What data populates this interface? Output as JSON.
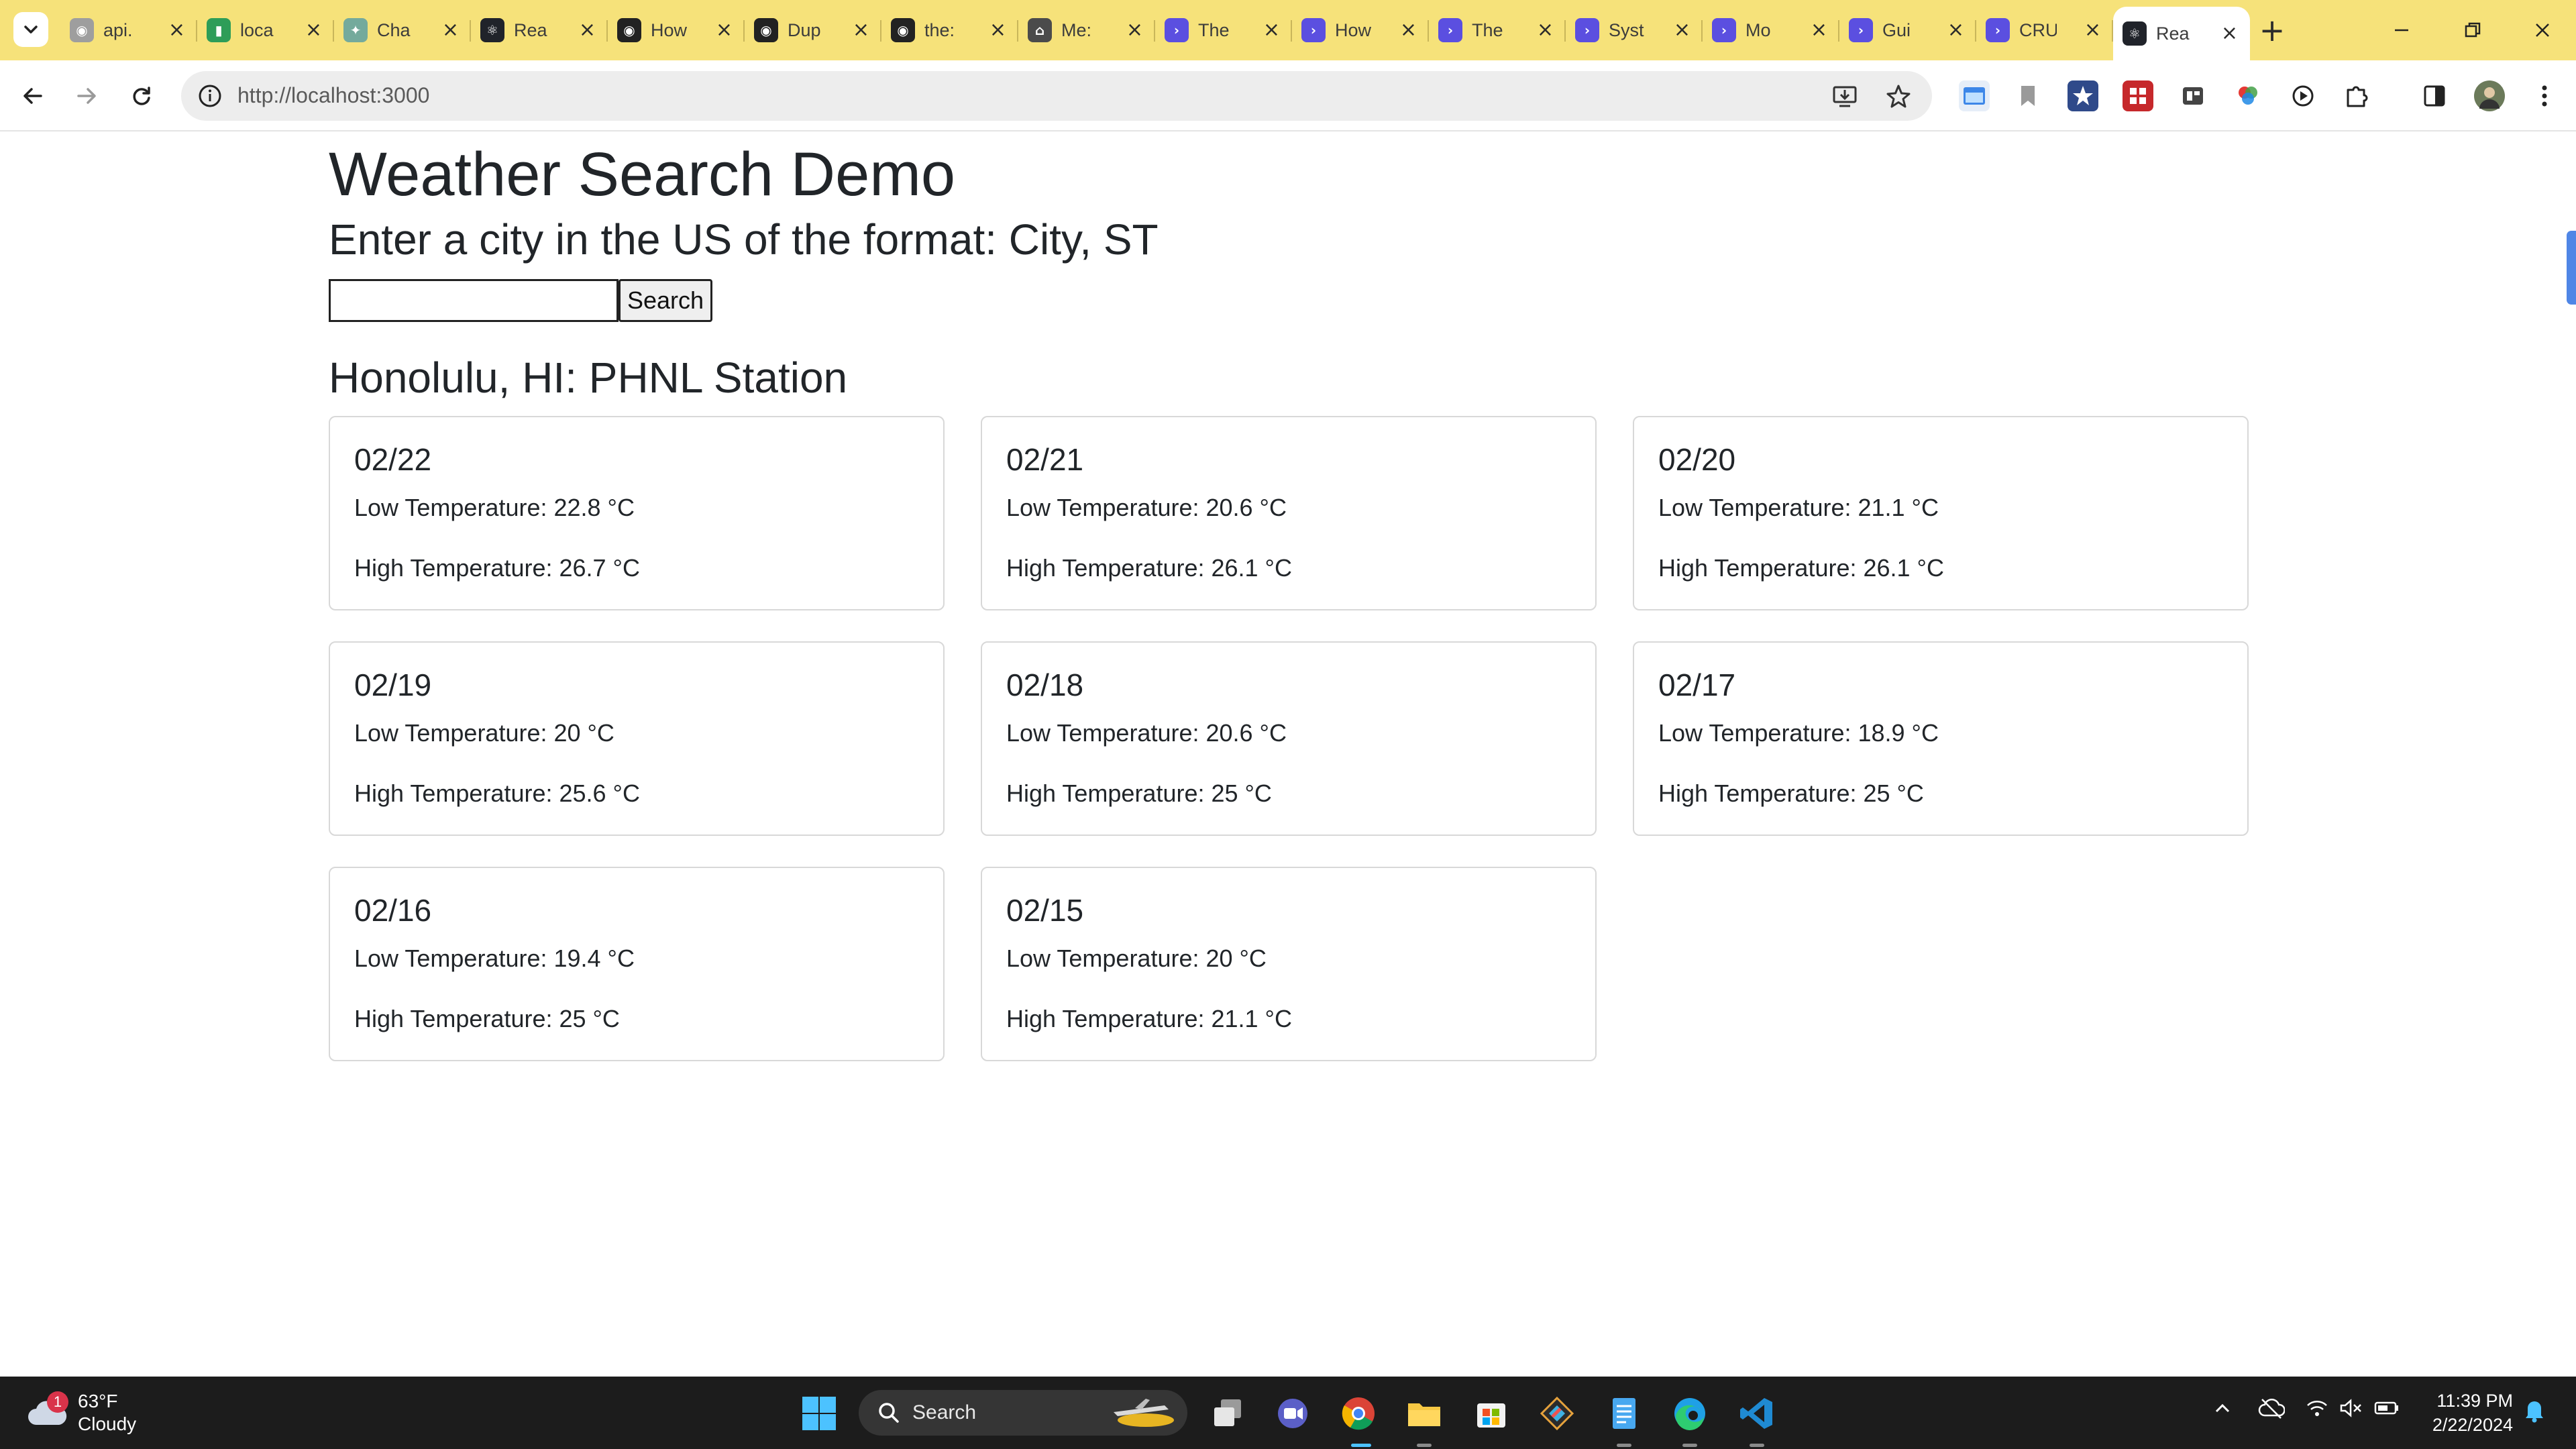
{
  "browser": {
    "tabs": [
      {
        "title": "api.",
        "icon": "github-icon",
        "color": "#9e9e9e"
      },
      {
        "title": "loca",
        "icon": "chart-icon",
        "color": "#2e9d58"
      },
      {
        "title": "Cha",
        "icon": "openai-icon",
        "color": "#74aa9c"
      },
      {
        "title": "Rea",
        "icon": "react-icon",
        "color": "#20232a"
      },
      {
        "title": "How",
        "icon": "github-icon",
        "color": "#222222"
      },
      {
        "title": "Dup",
        "icon": "github-icon",
        "color": "#222222"
      },
      {
        "title": "the:",
        "icon": "github-icon",
        "color": "#222222"
      },
      {
        "title": "Me:",
        "icon": "home-icon",
        "color": "#4b4b4b"
      },
      {
        "title": "The",
        "icon": "terminal-icon",
        "color": "#5b4fe0"
      },
      {
        "title": "How",
        "icon": "terminal-icon",
        "color": "#5b4fe0"
      },
      {
        "title": "The",
        "icon": "terminal-icon",
        "color": "#5b4fe0"
      },
      {
        "title": "Syst",
        "icon": "terminal-icon",
        "color": "#5b4fe0"
      },
      {
        "title": "Mo",
        "icon": "terminal-icon",
        "color": "#5b4fe0"
      },
      {
        "title": "Gui",
        "icon": "terminal-icon",
        "color": "#5b4fe0"
      },
      {
        "title": "CRU",
        "icon": "terminal-icon",
        "color": "#5b4fe0"
      },
      {
        "title": "Rea",
        "icon": "react-icon",
        "color": "#20232a"
      }
    ],
    "url": "http://localhost:3000"
  },
  "page": {
    "title": "Weather Search Demo",
    "subtitle": "Enter a city in the US of the format: City, ST",
    "search_value": "",
    "search_button": "Search",
    "station": "Honolulu, HI: PHNL Station",
    "days": [
      {
        "date": "02/22",
        "low": "Low Temperature: 22.8 °C",
        "high": "High Temperature: 26.7 °C"
      },
      {
        "date": "02/21",
        "low": "Low Temperature: 20.6 °C",
        "high": "High Temperature: 26.1 °C"
      },
      {
        "date": "02/20",
        "low": "Low Temperature: 21.1 °C",
        "high": "High Temperature: 26.1 °C"
      },
      {
        "date": "02/19",
        "low": "Low Temperature: 20 °C",
        "high": "High Temperature: 25.6 °C"
      },
      {
        "date": "02/18",
        "low": "Low Temperature: 20.6 °C",
        "high": "High Temperature: 25 °C"
      },
      {
        "date": "02/17",
        "low": "Low Temperature: 18.9 °C",
        "high": "High Temperature: 25 °C"
      },
      {
        "date": "02/16",
        "low": "Low Temperature: 19.4 °C",
        "high": "High Temperature: 25 °C"
      },
      {
        "date": "02/15",
        "low": "Low Temperature: 20 °C",
        "high": "High Temperature: 21.1 °C"
      }
    ]
  },
  "taskbar": {
    "weather_temp": "63°F",
    "weather_cond": "Cloudy",
    "weather_badge": "1",
    "search_label": "Search",
    "time": "11:39 PM",
    "date": "2/22/2024"
  }
}
